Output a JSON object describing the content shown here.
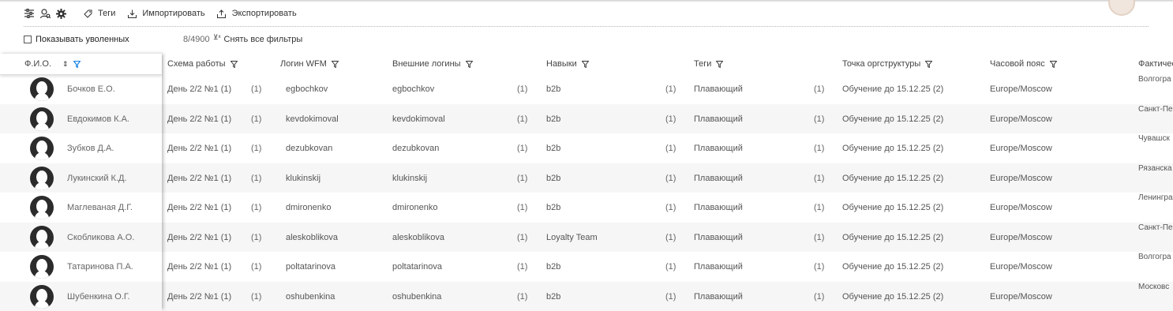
{
  "toolbar": {
    "icons": [
      "settings-sliders-icon",
      "user-search-icon",
      "gear-icon"
    ],
    "tags_label": "Теги",
    "import_label": "Импортировать",
    "export_label": "Экспортировать"
  },
  "filters": {
    "show_fired_label": "Показывать уволенных",
    "show_fired_checked": false,
    "counter": "8/4900",
    "clear_label": "Снять все фильтры"
  },
  "columns": {
    "fio": "Ф.И.О.",
    "schedule": "Схема работы",
    "wfm_login": "Логин WFM",
    "ext_logins": "Внешние логины",
    "skills": "Навыки",
    "tags": "Теги",
    "org_point": "Точка оргструктуры",
    "timezone": "Часовой пояс",
    "actual": "Фактичес"
  },
  "rows": [
    {
      "fio": "Бочков Е.О.",
      "schedule": "День 2/2 №1 (1)",
      "c1": "(1)",
      "login": "egbochkov",
      "ext": "egbochkov",
      "c2": "(1)",
      "skill": "b2b",
      "c3": "(1)",
      "tag": "Плавающий",
      "c4": "(1)",
      "org": "Обучение до 15.12.25 (2)",
      "tz": "Europe/Moscow",
      "region": "Волгогра"
    },
    {
      "fio": "Евдокимов К.А.",
      "schedule": "День 2/2 №1 (1)",
      "c1": "(1)",
      "login": "kevdokimoval",
      "ext": "kevdokimoval",
      "c2": "(1)",
      "skill": "b2b",
      "c3": "(1)",
      "tag": "Плавающий",
      "c4": "(1)",
      "org": "Обучение до 15.12.25 (2)",
      "tz": "Europe/Moscow",
      "region": "Санкт-Пе"
    },
    {
      "fio": "Зубков Д.А.",
      "schedule": "День 2/2 №1 (1)",
      "c1": "(1)",
      "login": "dezubkovan",
      "ext": "dezubkovan",
      "c2": "(1)",
      "skill": "b2b",
      "c3": "(1)",
      "tag": "Плавающий",
      "c4": "(1)",
      "org": "Обучение до 15.12.25 (2)",
      "tz": "Europe/Moscow",
      "region": "Чувашск"
    },
    {
      "fio": "Лукинский К.Д.",
      "schedule": "День 2/2 №1 (1)",
      "c1": "(1)",
      "login": "klukinskij",
      "ext": "klukinskij",
      "c2": "(1)",
      "skill": "b2b",
      "c3": "(1)",
      "tag": "Плавающий",
      "c4": "(1)",
      "org": "Обучение до 15.12.25 (2)",
      "tz": "Europe/Moscow",
      "region": "Рязанска"
    },
    {
      "fio": "Маглеваная Д.Г.",
      "schedule": "День 2/2 №1 (1)",
      "c1": "(1)",
      "login": "dmironenko",
      "ext": "dmironenko",
      "c2": "(1)",
      "skill": "b2b",
      "c3": "(1)",
      "tag": "Плавающий",
      "c4": "(1)",
      "org": "Обучение до 15.12.25 (2)",
      "tz": "Europe/Moscow",
      "region": "Ленингра"
    },
    {
      "fio": "Скобликова А.О.",
      "schedule": "День 2/2 №1 (1)",
      "c1": "(1)",
      "login": "aleskoblikova",
      "ext": "aleskoblikova",
      "c2": "(1)",
      "skill": "Loyalty Team",
      "c3": "(1)",
      "tag": "Плавающий",
      "c4": "(1)",
      "org": "Обучение до 15.12.25 (2)",
      "tz": "Europe/Moscow",
      "region": "Санкт-Пе"
    },
    {
      "fio": "Татаринова П.А.",
      "schedule": "День 2/2 №1 (1)",
      "c1": "(1)",
      "login": "poltatarinova",
      "ext": "poltatarinova",
      "c2": "(1)",
      "skill": "b2b",
      "c3": "(1)",
      "tag": "Плавающий",
      "c4": "(1)",
      "org": "Обучение до 15.12.25 (2)",
      "tz": "Europe/Moscow",
      "region": "Волгогра"
    },
    {
      "fio": "Шубенкина О.Г.",
      "schedule": "День 2/2 №1 (1)",
      "c1": "(1)",
      "login": "oshubenkina",
      "ext": "oshubenkina",
      "c2": "(1)",
      "skill": "b2b",
      "c3": "(1)",
      "tag": "Плавающий",
      "c4": "(1)",
      "org": "Обучение до 15.12.25 (2)",
      "tz": "Europe/Moscow",
      "region": "Московс"
    }
  ],
  "colors": {
    "accent": "#1e88e5",
    "text": "#555555",
    "row_alt": "#f6f6f6"
  }
}
